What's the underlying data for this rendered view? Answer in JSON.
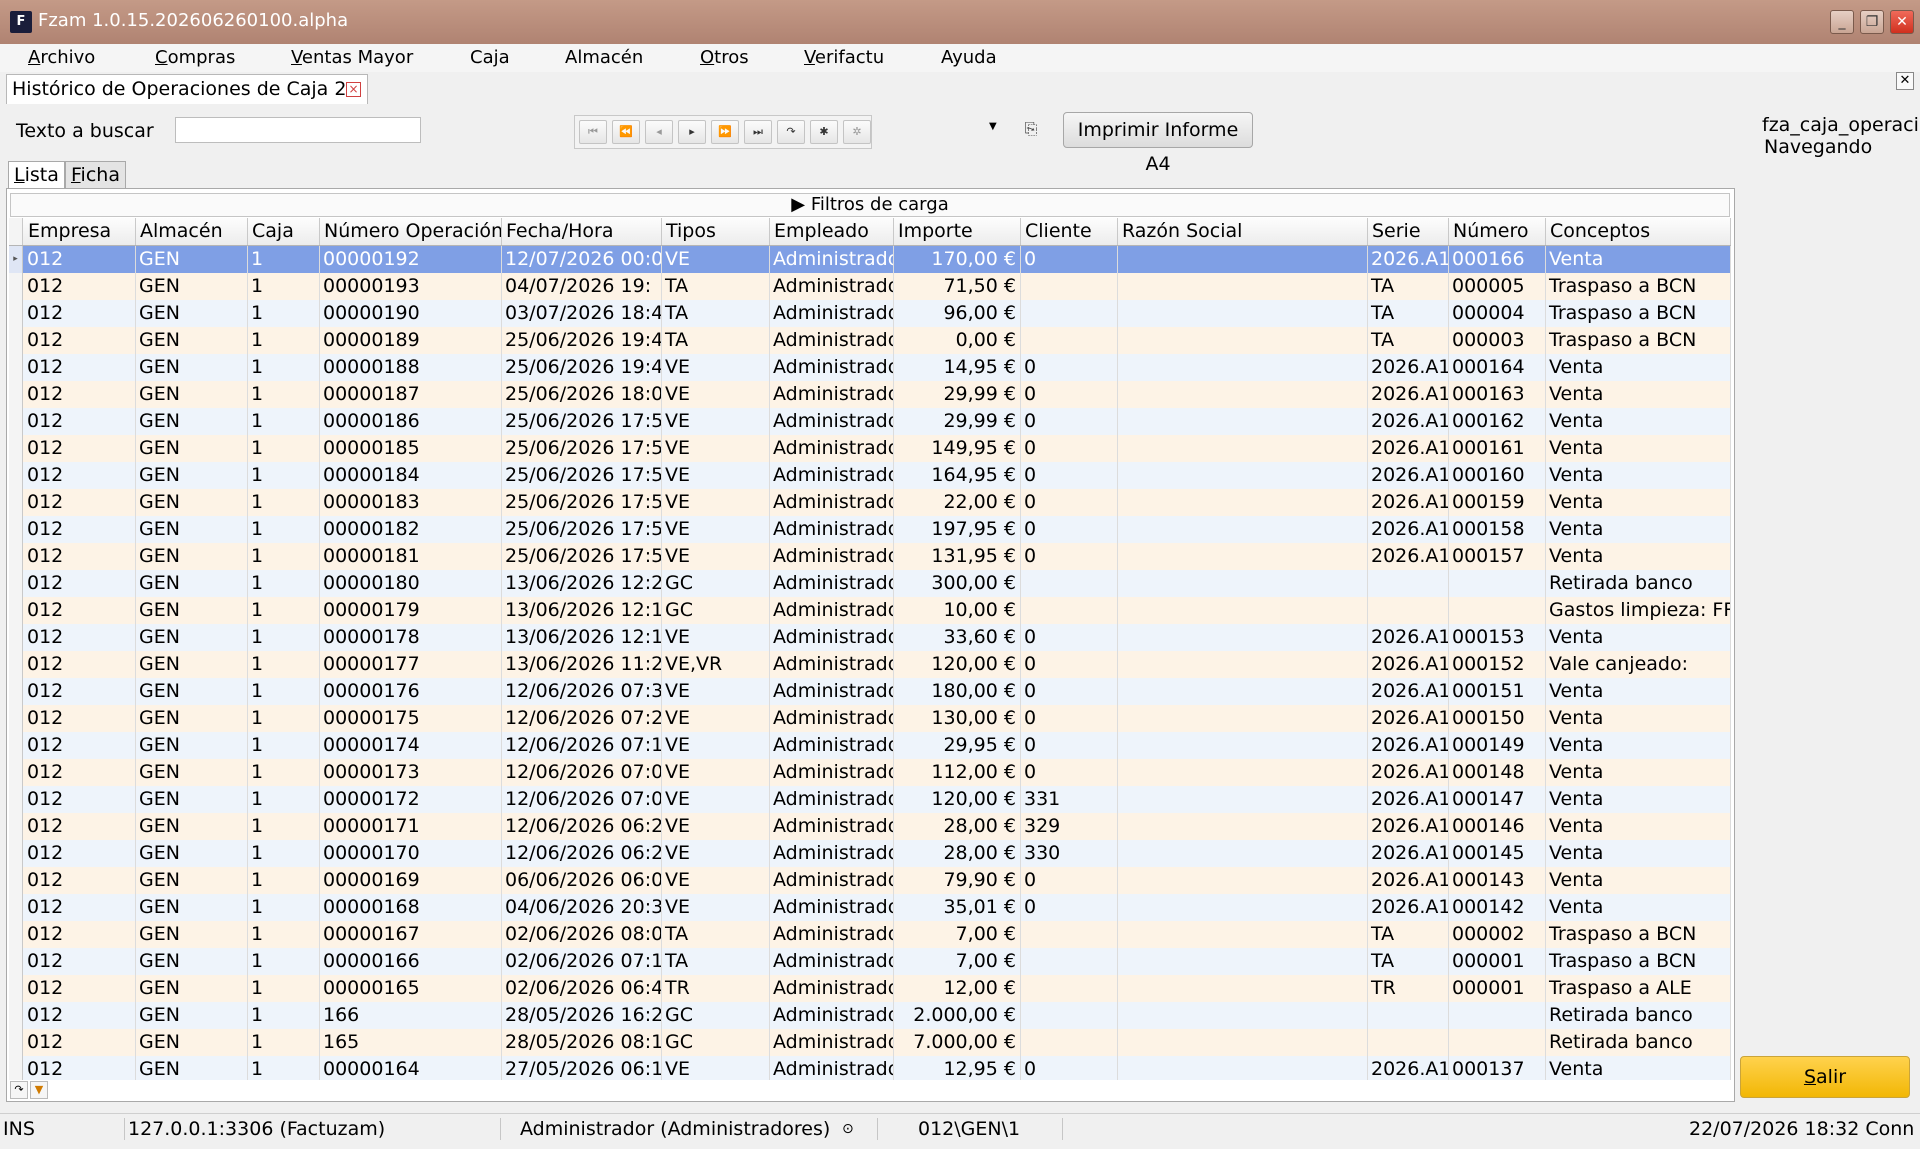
{
  "window": {
    "title": "Fzam 1.0.15.202606260100.alpha",
    "app_icon": "F",
    "controls": [
      "minimize-icon",
      "restore-icon",
      "close-icon"
    ]
  },
  "menu": [
    {
      "label": "Archivo",
      "ul": "A",
      "rest": "rchivo"
    },
    {
      "label": "Compras",
      "ul": "C",
      "rest": "ompras"
    },
    {
      "label": "Ventas Mayor",
      "ul": "V",
      "rest": "entas Mayor"
    },
    {
      "label": "Caja",
      "ul": "",
      "rest": "Caja"
    },
    {
      "label": "Almacén",
      "ul": "",
      "rest": "Almacén"
    },
    {
      "label": "Otros",
      "ul": "O",
      "rest": "tros"
    },
    {
      "label": "Verifactu",
      "ul": "V",
      "rest": "erifactu"
    },
    {
      "label": "Ayuda",
      "ul": "",
      "rest": "Ayuda"
    }
  ],
  "doc_tab": {
    "label": "Histórico de Operaciones de Caja 2",
    "close": "×"
  },
  "search": {
    "label": "Texto a buscar",
    "value": ""
  },
  "print_button": "Imprimir Informe A4",
  "info": {
    "name": "fza_caja_operaci",
    "state": "Navegando"
  },
  "subtabs": [
    {
      "ul": "L",
      "rest": "ista",
      "active": true
    },
    {
      "ul": "F",
      "rest": "icha",
      "active": false
    }
  ],
  "filters_label": "▶  Filtros de carga",
  "columns": [
    "Empresa",
    "Almacén",
    "Caja",
    "Número Operación",
    "Fecha/Hora",
    "Tipos",
    "Empleado",
    "Importe",
    "Cliente",
    "Razón Social",
    "Serie",
    "Número",
    "Conceptos"
  ],
  "rows": [
    [
      "012",
      "GEN",
      "1",
      "00000192",
      "12/07/2026 00:0",
      "VE",
      "Administrado",
      "170,00 €",
      "0",
      "",
      "2026.A1",
      "000166",
      "Venta"
    ],
    [
      "012",
      "GEN",
      "1",
      "00000193",
      "04/07/2026 19:",
      "TA",
      "Administrado",
      "71,50 €",
      "",
      "",
      "TA",
      "000005",
      "Traspaso a BCN"
    ],
    [
      "012",
      "GEN",
      "1",
      "00000190",
      "03/07/2026 18:4",
      "TA",
      "Administrado",
      "96,00 €",
      "",
      "",
      "TA",
      "000004",
      "Traspaso a BCN"
    ],
    [
      "012",
      "GEN",
      "1",
      "00000189",
      "25/06/2026 19:4",
      "TA",
      "Administrado",
      "0,00 €",
      "",
      "",
      "TA",
      "000003",
      "Traspaso a BCN"
    ],
    [
      "012",
      "GEN",
      "1",
      "00000188",
      "25/06/2026 19:4",
      "VE",
      "Administrado",
      "14,95 €",
      "0",
      "",
      "2026.A1",
      "000164",
      "Venta"
    ],
    [
      "012",
      "GEN",
      "1",
      "00000187",
      "25/06/2026 18:0",
      "VE",
      "Administrado",
      "29,99 €",
      "0",
      "",
      "2026.A1",
      "000163",
      "Venta"
    ],
    [
      "012",
      "GEN",
      "1",
      "00000186",
      "25/06/2026 17:5",
      "VE",
      "Administrado",
      "29,99 €",
      "0",
      "",
      "2026.A1",
      "000162",
      "Venta"
    ],
    [
      "012",
      "GEN",
      "1",
      "00000185",
      "25/06/2026 17:5",
      "VE",
      "Administrado",
      "149,95 €",
      "0",
      "",
      "2026.A1",
      "000161",
      "Venta"
    ],
    [
      "012",
      "GEN",
      "1",
      "00000184",
      "25/06/2026 17:5",
      "VE",
      "Administrado",
      "164,95 €",
      "0",
      "",
      "2026.A1",
      "000160",
      "Venta"
    ],
    [
      "012",
      "GEN",
      "1",
      "00000183",
      "25/06/2026 17:5",
      "VE",
      "Administrado",
      "22,00 €",
      "0",
      "",
      "2026.A1",
      "000159",
      "Venta"
    ],
    [
      "012",
      "GEN",
      "1",
      "00000182",
      "25/06/2026 17:5",
      "VE",
      "Administrado",
      "197,95 €",
      "0",
      "",
      "2026.A1",
      "000158",
      "Venta"
    ],
    [
      "012",
      "GEN",
      "1",
      "00000181",
      "25/06/2026 17:5",
      "VE",
      "Administrado",
      "131,95 €",
      "0",
      "",
      "2026.A1",
      "000157",
      "Venta"
    ],
    [
      "012",
      "GEN",
      "1",
      "00000180",
      "13/06/2026 12:2",
      "GC",
      "Administrado",
      "300,00 €",
      "",
      "",
      "",
      "",
      "Retirada banco"
    ],
    [
      "012",
      "GEN",
      "1",
      "00000179",
      "13/06/2026 12:1",
      "GC",
      "Administrado",
      "10,00 €",
      "",
      "",
      "",
      "",
      "Gastos limpieza: FR"
    ],
    [
      "012",
      "GEN",
      "1",
      "00000178",
      "13/06/2026 12:1",
      "VE",
      "Administrado",
      "33,60 €",
      "0",
      "",
      "2026.A1",
      "000153",
      "Venta"
    ],
    [
      "012",
      "GEN",
      "1",
      "00000177",
      "13/06/2026 11:2",
      "VE,VR",
      "Administrado",
      "120,00 €",
      "0",
      "",
      "2026.A1",
      "000152",
      "Vale canjeado:"
    ],
    [
      "012",
      "GEN",
      "1",
      "00000176",
      "12/06/2026 07:3",
      "VE",
      "Administrado",
      "180,00 €",
      "0",
      "",
      "2026.A1",
      "000151",
      "Venta"
    ],
    [
      "012",
      "GEN",
      "1",
      "00000175",
      "12/06/2026 07:2",
      "VE",
      "Administrado",
      "130,00 €",
      "0",
      "",
      "2026.A1",
      "000150",
      "Venta"
    ],
    [
      "012",
      "GEN",
      "1",
      "00000174",
      "12/06/2026 07:1",
      "VE",
      "Administrado",
      "29,95 €",
      "0",
      "",
      "2026.A1",
      "000149",
      "Venta"
    ],
    [
      "012",
      "GEN",
      "1",
      "00000173",
      "12/06/2026 07:0",
      "VE",
      "Administrado",
      "112,00 €",
      "0",
      "",
      "2026.A1",
      "000148",
      "Venta"
    ],
    [
      "012",
      "GEN",
      "1",
      "00000172",
      "12/06/2026 07:0",
      "VE",
      "Administrado",
      "120,00 €",
      "331",
      "",
      "2026.A1",
      "000147",
      "Venta"
    ],
    [
      "012",
      "GEN",
      "1",
      "00000171",
      "12/06/2026 06:2",
      "VE",
      "Administrado",
      "28,00 €",
      "329",
      "",
      "2026.A1",
      "000146",
      "Venta"
    ],
    [
      "012",
      "GEN",
      "1",
      "00000170",
      "12/06/2026 06:2",
      "VE",
      "Administrado",
      "28,00 €",
      "330",
      "",
      "2026.A1",
      "000145",
      "Venta"
    ],
    [
      "012",
      "GEN",
      "1",
      "00000169",
      "06/06/2026 06:0",
      "VE",
      "Administrado",
      "79,90 €",
      "0",
      "",
      "2026.A1",
      "000143",
      "Venta"
    ],
    [
      "012",
      "GEN",
      "1",
      "00000168",
      "04/06/2026 20:3",
      "VE",
      "Administrado",
      "35,01 €",
      "0",
      "",
      "2026.A1",
      "000142",
      "Venta"
    ],
    [
      "012",
      "GEN",
      "1",
      "00000167",
      "02/06/2026 08:0",
      "TA",
      "Administrado",
      "7,00 €",
      "",
      "",
      "TA",
      "000002",
      "Traspaso a BCN"
    ],
    [
      "012",
      "GEN",
      "1",
      "00000166",
      "02/06/2026 07:1",
      "TA",
      "Administrado",
      "7,00 €",
      "",
      "",
      "TA",
      "000001",
      "Traspaso a BCN"
    ],
    [
      "012",
      "GEN",
      "1",
      "00000165",
      "02/06/2026 06:4",
      "TR",
      "Administrado",
      "12,00 €",
      "",
      "",
      "TR",
      "000001",
      "Traspaso a ALE"
    ],
    [
      "012",
      "GEN",
      "1",
      "166",
      "28/05/2026 16:2",
      "GC",
      "Administrado",
      "2.000,00 €",
      "",
      "",
      "",
      "",
      "Retirada banco"
    ],
    [
      "012",
      "GEN",
      "1",
      "165",
      "28/05/2026 08:1",
      "GC",
      "Administrado",
      "7.000,00 €",
      "",
      "",
      "",
      "",
      "Retirada banco"
    ],
    [
      "012",
      "GEN",
      "1",
      "00000164",
      "27/05/2026 06:1",
      "VE",
      "Administrado",
      "12,95 €",
      "0",
      "",
      "2026.A1",
      "000137",
      "Venta"
    ]
  ],
  "exit_button": {
    "ul": "S",
    "rest": "alir"
  },
  "status": {
    "mode": "INS",
    "db": "127.0.0.1:3306 (Factuzam)",
    "user": "Administrador (Administradores)",
    "path": "012\\GEN\\1",
    "datetime": "22/07/2026 18:32 Conn"
  },
  "colors": {
    "selected_row": "#7f9fe5",
    "row_alt_a": "#fdf3e6",
    "row_alt_b": "#eef4fb",
    "exit_button": "#f2b705",
    "titlebar": "#b08372"
  }
}
